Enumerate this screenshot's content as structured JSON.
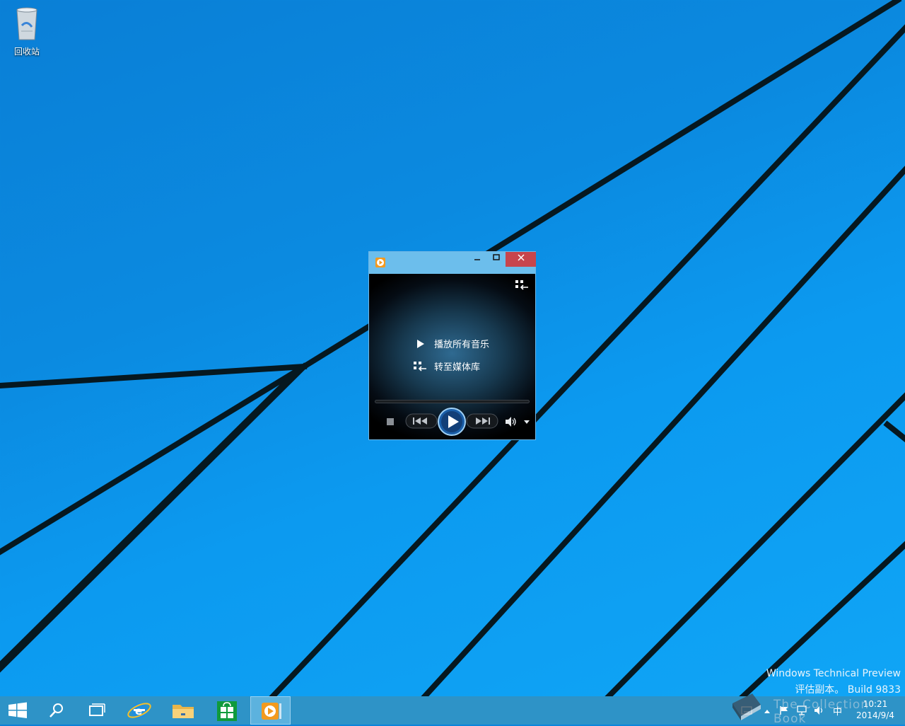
{
  "desktop": {
    "recycle_bin_label": "回收站",
    "watermark_line1": "Windows Technical Preview",
    "watermark_line2": "评估副本。 Build 9833",
    "colors": {
      "wallpaper": "#0b8ae0",
      "lines": "#071a24"
    }
  },
  "player": {
    "menu": {
      "play_all": "播放所有音乐",
      "go_library": "转至媒体库"
    },
    "titlebar_buttons": [
      "minimize",
      "maximize",
      "close"
    ],
    "colors": {
      "titlebar": "#6cbeec",
      "close": "#c7454c"
    }
  },
  "taskbar": {
    "icons": [
      "start-icon",
      "search-icon",
      "task-view-icon",
      "internet-explorer-icon",
      "file-explorer-icon",
      "store-icon",
      "media-player-icon"
    ],
    "tray": {
      "ime": "中",
      "time": "10:21",
      "date": "2014/9/4"
    },
    "overlay_text": "The Collection Book"
  }
}
